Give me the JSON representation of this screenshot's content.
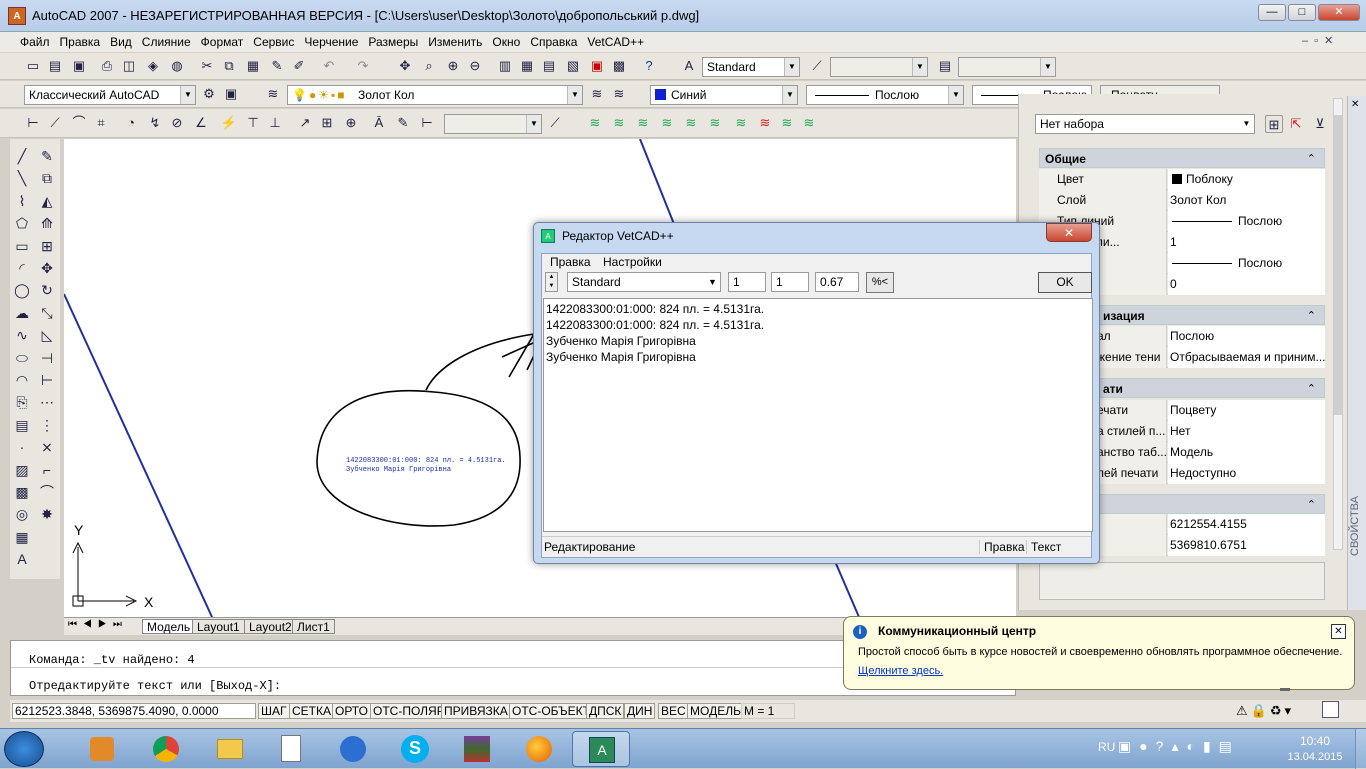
{
  "window": {
    "title": "AutoCAD 2007 - НЕЗАРЕГИСТРИРОВАННАЯ ВЕРСИЯ - [C:\\Users\\user\\Desktop\\Золото\\добропольський р.dwg]"
  },
  "menu": [
    "Файл",
    "Правка",
    "Вид",
    "Слияние",
    "Формат",
    "Сервис",
    "Черчение",
    "Размеры",
    "Изменить",
    "Окно",
    "Справка",
    "VetCAD++"
  ],
  "toolbar": {
    "text_style": "Standard",
    "workspace": "Классический AutoCAD",
    "layer": "Золот Кол",
    "color": "Синий",
    "linetype": "Послою",
    "lineweight": "Послою",
    "plotstyle": "Поцвету"
  },
  "icons": {
    "draw": [
      "line",
      "xline",
      "polyline",
      "polygon",
      "rectangle",
      "arc",
      "circle",
      "revcloud",
      "spline",
      "ellipse",
      "ellipse-arc",
      "insert",
      "block",
      "point",
      "hatch",
      "gradient",
      "region",
      "table",
      "mtext"
    ],
    "modify": [
      "erase",
      "copy",
      "mirror",
      "offset",
      "array",
      "move",
      "rotate",
      "scale",
      "stretch",
      "trim",
      "extend",
      "break-at-point",
      "break",
      "join",
      "chamfer",
      "fillet",
      "explode"
    ]
  },
  "drawing": {
    "annotation_line1": "1422083300:01:000: 824 пл. = 4.5131га.",
    "annotation_line2": "Зубченко Марія Григорівна",
    "axis_y": "Y",
    "axis_x": "X"
  },
  "layout_tabs": [
    "Модель",
    "Layout1",
    "Layout2",
    "Лист1"
  ],
  "command": {
    "line1": "Команда: _tv найдено: 4",
    "line2": "Отредактируйте текст или [Выход-X]:"
  },
  "status": {
    "coords": "6212523.3848, 5369875.4090, 0.0000",
    "buttons": [
      "ШАГ",
      "СЕТКА",
      "ОРТО",
      "ОТС-ПОЛЯР",
      "ПРИВЯЗКА",
      "ОТС-ОБЪЕКТ",
      "ДПСК",
      "ДИН",
      "ВЕС",
      "МОДЕЛЬ"
    ],
    "m_label": "M = 1"
  },
  "properties": {
    "selection": "Нет набора",
    "side_label": "СВОЙСТВА",
    "sections": {
      "general": "Общие",
      "visualization": "изация",
      "print": "ати"
    },
    "general_rows": [
      {
        "k": "Цвет",
        "v": "Поблоку"
      },
      {
        "k": "Слой",
        "v": "Золот Кол"
      },
      {
        "k": "Тип линий",
        "v": "Послою"
      },
      {
        "k": "б типа ли...",
        "v": "1"
      },
      {
        "k": "ий",
        "v": "Послою"
      },
      {
        "k": "",
        "v": "0"
      }
    ],
    "visual_rows": [
      {
        "k": "ал",
        "v": "Послою"
      },
      {
        "k": "жение тени",
        "v": "Отбрасываемая и приним..."
      }
    ],
    "print_rows": [
      {
        "k": "ечати",
        "v": "Поцвету"
      },
      {
        "k": "а стилей п...",
        "v": "Нет"
      },
      {
        "k": "анство таб...",
        "v": "Модель"
      },
      {
        "k": "лей печати",
        "v": "Недоступно"
      }
    ],
    "view_rows": [
      {
        "k": "",
        "v": "6212554.4155"
      },
      {
        "k": "",
        "v": "5369810.6751"
      }
    ]
  },
  "editor": {
    "title": "Редактор VetCAD++",
    "menu": [
      "Правка",
      "Настройки"
    ],
    "style": "Standard",
    "val1": "1",
    "val2": "1",
    "val3": "0.67",
    "pct_label": "%<",
    "ok_label": "OK",
    "lines": [
      "1422083300:01:000: 824 пл. = 4.5131га.",
      "1422083300:01:000: 824 пл. = 4.5131га.",
      "Зубченко Марія Григорівна",
      "Зубченко Марія Григорівна"
    ],
    "status_left": "Редактирование",
    "status_mid": "Правка",
    "status_right": "Текст"
  },
  "notification": {
    "title": "Коммуникационный центр",
    "body": "Простой способ быть в курсе новостей и своевременно обновлять программное обеспечение.",
    "link": "Щелкните здесь."
  },
  "tray": {
    "lang": "RU",
    "time": "10:40",
    "date": "13.04.2015"
  },
  "colors": {
    "accent": "#0a7fd6",
    "drawing_line": "#2030a0",
    "annotation": "#1a2fb0"
  }
}
